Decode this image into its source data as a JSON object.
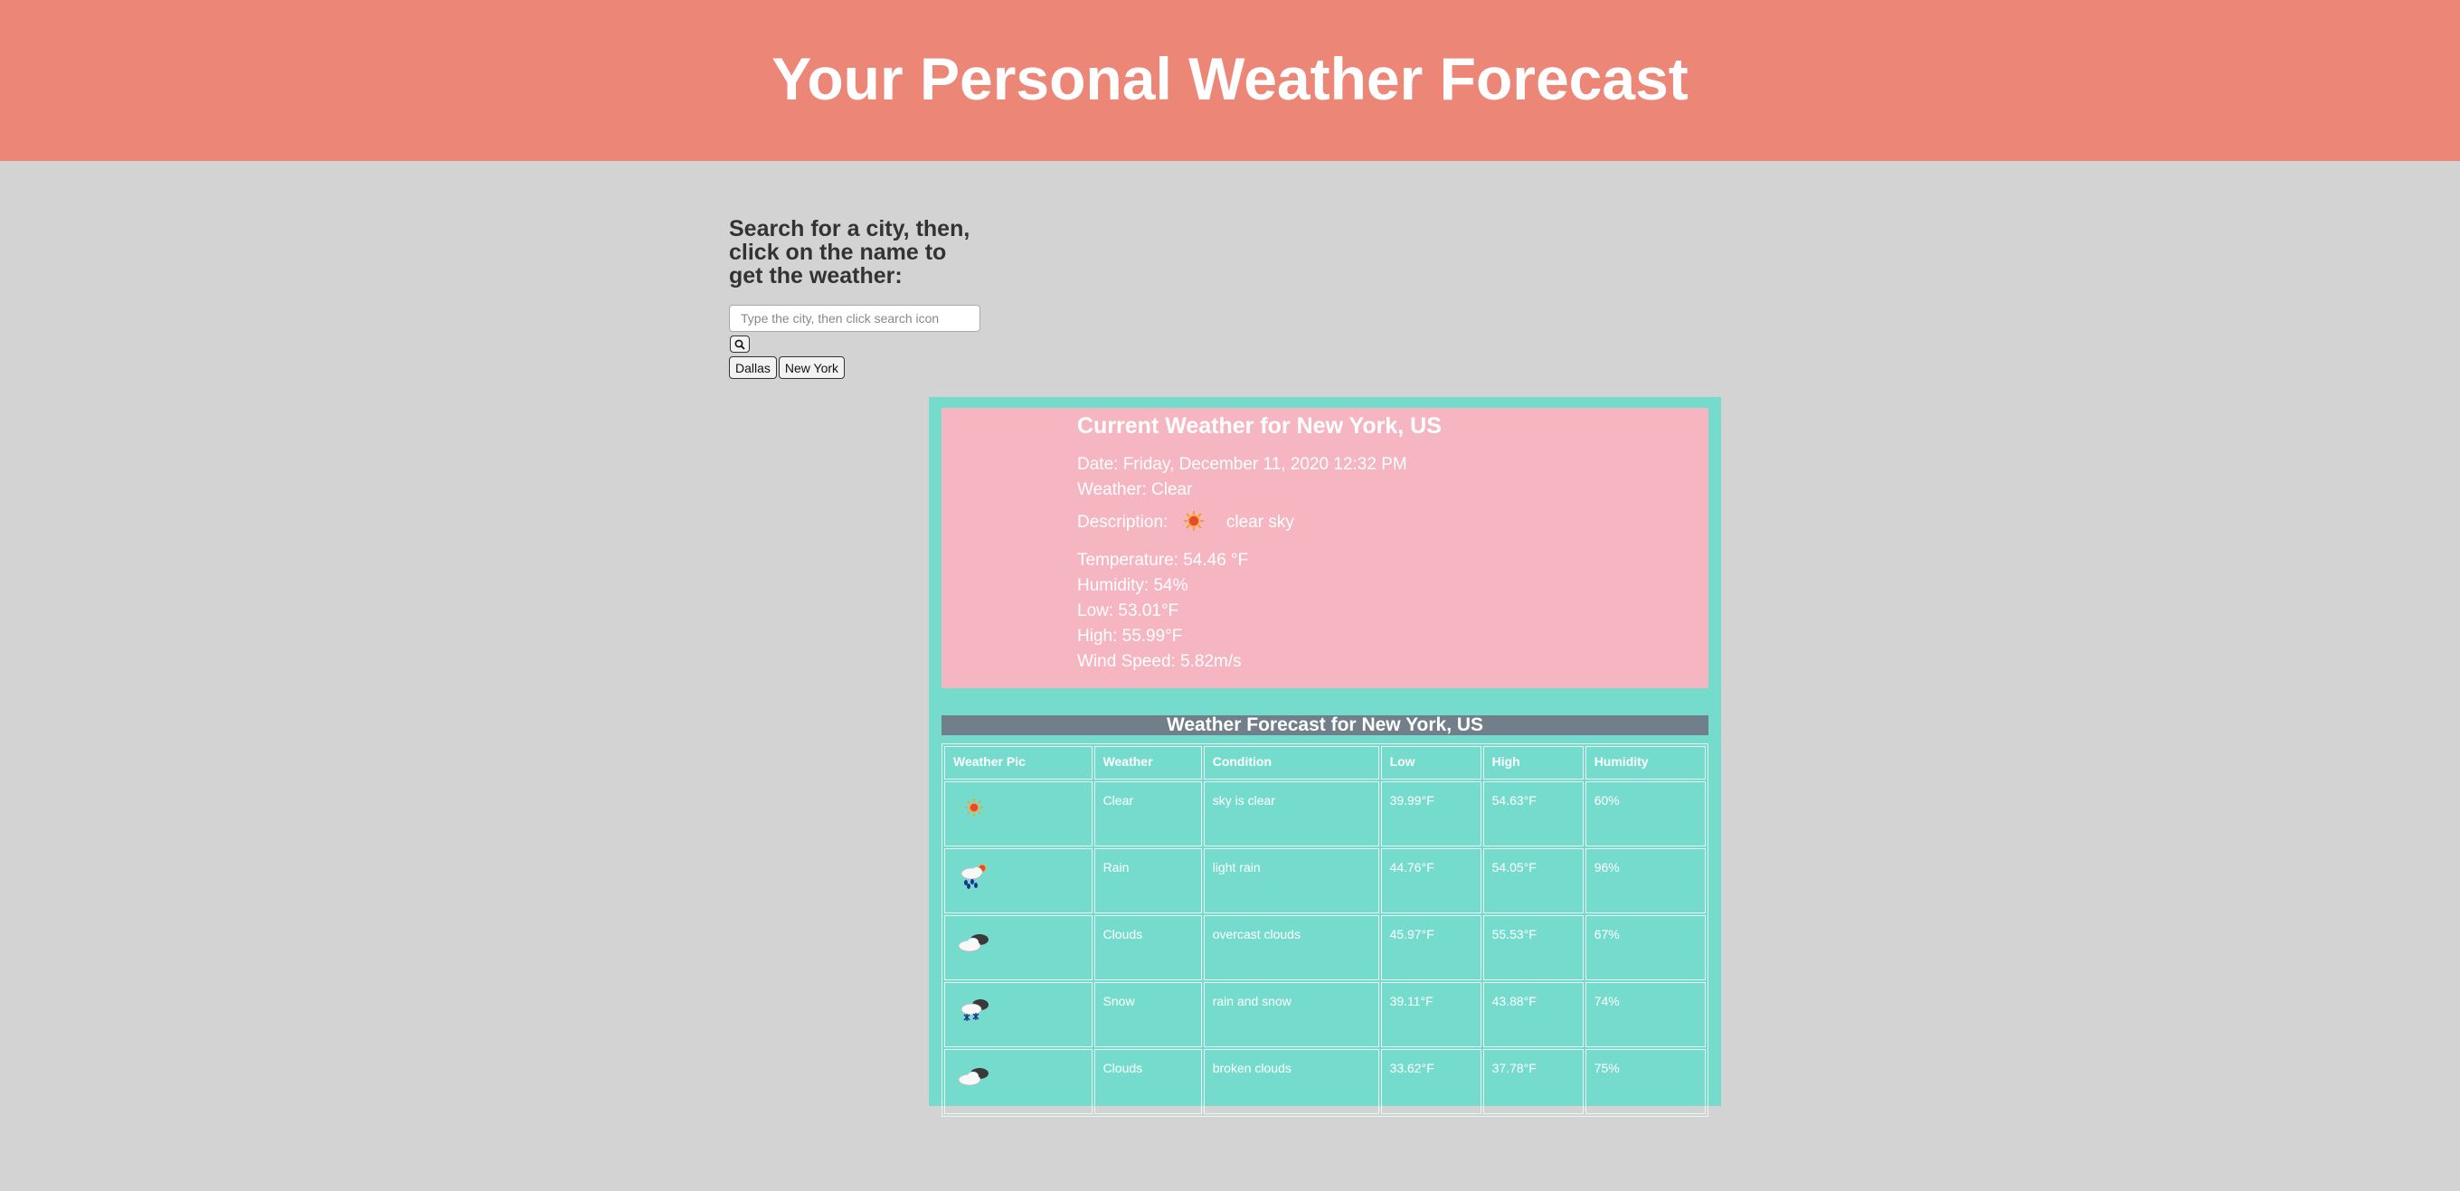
{
  "header": {
    "title": "Your Personal Weather Forecast"
  },
  "search": {
    "prompt": "Search for a city, then, click on the name to get the weather:",
    "placeholder": "Type the city, then click search icon",
    "button_icon": "search-icon",
    "history": [
      "Dallas",
      "New York"
    ]
  },
  "current": {
    "title": "Current Weather for New York, US",
    "date": "Date: Friday, December 11, 2020 12:32 PM",
    "weather": "Weather: Clear",
    "description_label": "Description:",
    "description_icon": "sun-icon",
    "description": "clear sky",
    "temperature": "Temperature: 54.46 °F",
    "humidity": "Humidity: 54%",
    "low": "Low: 53.01°F",
    "high": "High: 55.99°F",
    "wind": "Wind Speed: 5.82m/s"
  },
  "forecast": {
    "title": "Weather Forecast for New York, US",
    "columns": [
      "Weather Pic",
      "Weather",
      "Condition",
      "Low",
      "High",
      "Humidity"
    ],
    "rows": [
      {
        "icon": "sun-icon",
        "weather": "Clear",
        "condition": "sky is clear",
        "low": "39.99°F",
        "high": "54.63°F",
        "humidity": "60%"
      },
      {
        "icon": "rain-icon",
        "weather": "Rain",
        "condition": "light rain",
        "low": "44.76°F",
        "high": "54.05°F",
        "humidity": "96%"
      },
      {
        "icon": "cloud-icon",
        "weather": "Clouds",
        "condition": "overcast clouds",
        "low": "45.97°F",
        "high": "55.53°F",
        "humidity": "67%"
      },
      {
        "icon": "snow-icon",
        "weather": "Snow",
        "condition": "rain and snow",
        "low": "39.11°F",
        "high": "43.88°F",
        "humidity": "74%"
      },
      {
        "icon": "cloud-icon",
        "weather": "Clouds",
        "condition": "broken clouds",
        "low": "33.62°F",
        "high": "37.78°F",
        "humidity": "75%"
      }
    ]
  },
  "colors": {
    "header_bg": "#ec8677",
    "page_bg": "#d3d3d3",
    "panel_bg": "#75dccd",
    "current_card_bg": "#f5b6c2",
    "forecast_title_bg": "#717f8a"
  }
}
